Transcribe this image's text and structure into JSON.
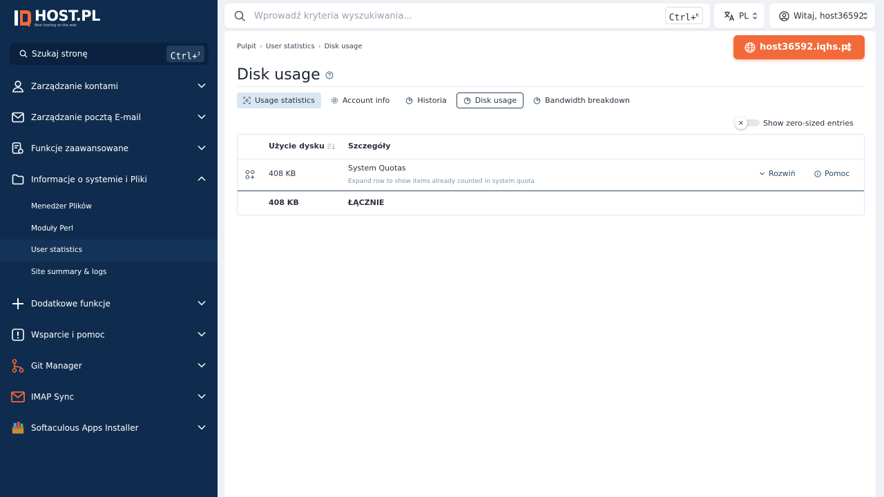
{
  "brand": {
    "name": "HOST.PL",
    "tagline": "Best hosting on the web"
  },
  "sidebar": {
    "search_label": "Szukaj stronę",
    "search_shortcut": "Ctrl+",
    "search_shortcut_key": "J",
    "items": [
      {
        "label": "Zarządzanie kontami",
        "icon": "user-icon",
        "expanded": false
      },
      {
        "label": "Zarządzanie pocztą E-mail",
        "icon": "mail-icon",
        "expanded": false
      },
      {
        "label": "Funkcje zaawansowane",
        "icon": "advanced-settings-icon",
        "expanded": false
      },
      {
        "label": "Informacje o systemie i Pliki",
        "icon": "folder-icon",
        "expanded": true
      },
      {
        "label": "Dodatkowe funkcje",
        "icon": "plus-icon",
        "expanded": false
      },
      {
        "label": "Wsparcie i pomoc",
        "icon": "alert-icon",
        "expanded": false
      },
      {
        "label": "Git Manager",
        "icon": "git-icon",
        "expanded": false
      },
      {
        "label": "IMAP Sync",
        "icon": "imap-mail-icon",
        "expanded": false
      },
      {
        "label": "Softaculous Apps Installer",
        "icon": "softaculous-icon",
        "expanded": false
      }
    ],
    "subitems": [
      {
        "label": "Menedżer Plików",
        "active": false
      },
      {
        "label": "Moduły Perl",
        "active": false
      },
      {
        "label": "User statistics",
        "active": true
      },
      {
        "label": "Site summary & logs",
        "active": false
      }
    ]
  },
  "topbar": {
    "search_placeholder": "Wprowadź kryteria wyszukiwania...",
    "search_shortcut": "Ctrl+",
    "search_shortcut_key": "K",
    "language": "PL",
    "greeting": "Witaj, host36592"
  },
  "breadcrumb": [
    "Pulpit",
    "User statistics",
    "Disk usage"
  ],
  "domain_selector": "host36592.iqhs.pl",
  "page_title": "Disk usage",
  "tabs": [
    {
      "label": "Usage statistics",
      "state": "highlighted"
    },
    {
      "label": "Account info",
      "state": "normal"
    },
    {
      "label": "Historia",
      "state": "normal"
    },
    {
      "label": "Disk usage",
      "state": "selected"
    },
    {
      "label": "Bandwidth breakdown",
      "state": "normal"
    }
  ],
  "zero_toggle": {
    "label": "Show zero-sized entries",
    "enabled": false
  },
  "table": {
    "columns": [
      "Użycie dysku",
      "Szczegóły"
    ],
    "rows": [
      {
        "size": "408 KB",
        "title": "System Quotas",
        "subtitle": "Expand row to show items already counted in system quota",
        "expand_label": "Rozwiń",
        "help_label": "Pomoc"
      }
    ],
    "total": {
      "size": "408 KB",
      "label": "ŁĄCZNIE"
    }
  },
  "colors": {
    "sidebar_bg": "#0f2c4e",
    "accent_orange": "#f26a3a",
    "tab_highlight": "#dbe6f3"
  }
}
